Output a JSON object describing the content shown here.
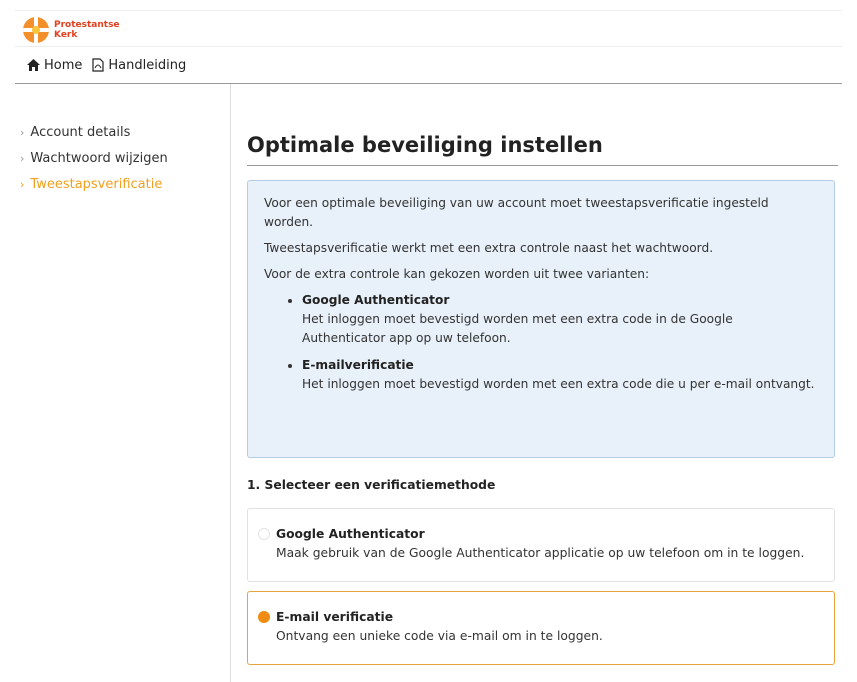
{
  "logo": {
    "line1": "Protestantse",
    "line2": "Kerk"
  },
  "nav": {
    "home": "Home",
    "manual": "Handleiding"
  },
  "sidebar": {
    "items": [
      {
        "label": "Account details"
      },
      {
        "label": "Wachtwoord wijzigen"
      },
      {
        "label": "Tweestapsverificatie"
      }
    ]
  },
  "main": {
    "title": "Optimale beveiliging instellen",
    "info": {
      "p1": "Voor een optimale beveiliging van uw account moet tweestapsverificatie ingesteld worden.",
      "p2": "Tweestapsverificatie werkt met een extra controle naast het wachtwoord.",
      "p3": "Voor de extra controle kan gekozen worden uit twee varianten:",
      "items": [
        {
          "title": "Google Authenticator",
          "text": "Het inloggen moet bevestigd worden met een extra code in de Google Authenticator app op uw telefoon."
        },
        {
          "title": "E-mailverificatie",
          "text": "Het inloggen moet bevestigd worden met een extra code die u per e-mail ontvangt."
        }
      ]
    },
    "step_label": "1. Selecteer een verificatiemethode",
    "options": [
      {
        "title": "Google Authenticator",
        "desc": "Maak gebruik van de Google Authenticator applicatie op uw telefoon om in te loggen."
      },
      {
        "title": "E-mail verificatie",
        "desc": "Ontvang een unieke code via e-mail om in te loggen."
      }
    ]
  },
  "colors": {
    "accent": "#f08c13",
    "info_bg": "#e8f1f9",
    "info_border": "#b4cde4"
  }
}
